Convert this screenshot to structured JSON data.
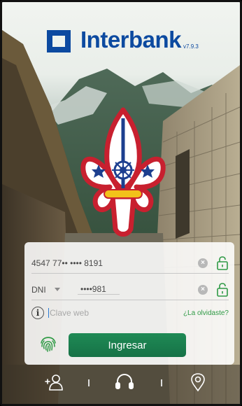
{
  "app": {
    "brand": "Interbank",
    "version": "v7.9.3"
  },
  "login_form": {
    "card_number": "4547 77•• •••• 8191",
    "document_type": "DNI",
    "document_number": "••••981",
    "password_placeholder": "Clave web",
    "forgot_link": "¿La olvidaste?",
    "submit_label": "Ingresar"
  },
  "bottom_bar": {
    "items": [
      {
        "icon": "add-user-icon"
      },
      {
        "icon": "headset-icon"
      },
      {
        "icon": "location-pin-icon"
      }
    ]
  },
  "colors": {
    "brand_blue": "#0c4aa0",
    "brand_green": "#1f8a55",
    "link_green": "#2f9a45",
    "emblem_red": "#c8202f",
    "emblem_blue": "#1d3f8f",
    "emblem_gold": "#f2c21a"
  }
}
